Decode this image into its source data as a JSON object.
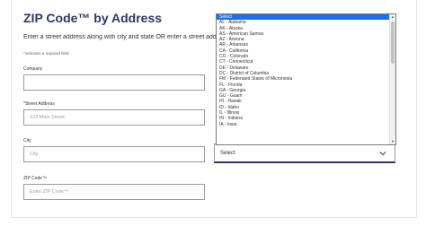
{
  "page": {
    "title": "ZIP Code™ by Address",
    "intro": "Enter a street address along with city and state OR enter a street address and ZIP Code",
    "required_note": "*indicates a required field"
  },
  "form": {
    "company": {
      "label": "Company",
      "placeholder": ""
    },
    "street": {
      "label": "*Street Address",
      "placeholder": "123 Main Street"
    },
    "city": {
      "label": "City",
      "placeholder": "City"
    },
    "state": {
      "selected": "Select"
    },
    "zip": {
      "label": "ZIP Code™",
      "placeholder": "Enter ZIP Code™"
    }
  },
  "state_options": [
    "Select",
    "AL - Alabama",
    "AK - Alaska",
    "AS - American Samoa",
    "AZ - Arizona",
    "AR - Arkansas",
    "CA - California",
    "CO - Colorado",
    "CT - Connecticut",
    "DE - Delaware",
    "DC - District of Columbia",
    "FM - Federated States of Micronesia",
    "FL - Florida",
    "GA - Georgia",
    "GU - Guam",
    "HI - Hawaii",
    "ID - Idaho",
    "IL - Illinois",
    "IN - Indiana",
    "IA - Iowa"
  ],
  "colors": {
    "title": "#333366",
    "highlight": "#1e6fe8",
    "border": "#9a9a9a"
  },
  "icons": {
    "chevron": "chevron-down-icon"
  }
}
